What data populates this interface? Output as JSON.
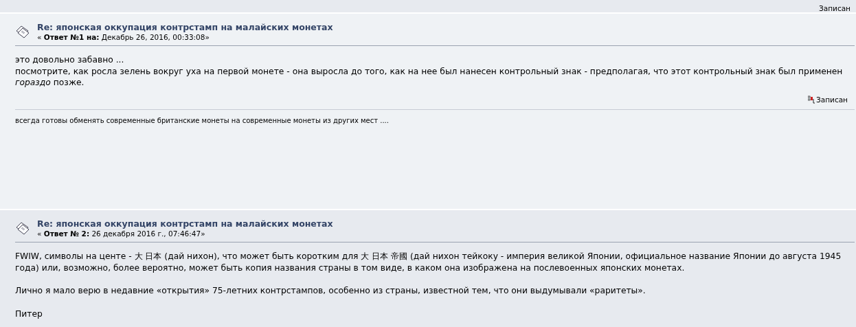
{
  "previous_post": {
    "report_link": "Записан"
  },
  "posts": [
    {
      "title": "Re: японская оккупация контрстамп на малайских монетах",
      "meta": "« **Ответ №1 на:** Декабрь 26, 2016, 00:33:08»",
      "paragraphs": [
        [
          "это довольно забавно ...",
          "посмотрите, как росла зелень вокруг уха на первой монете - она выросла до того, как на нее был нанесен контрольный знак - предполагая, что этот контрольный знак был применен *гораздо* позже."
        ]
      ],
      "report_link": "Записан",
      "signature": "всегда готовы обменять современные британские монеты на современные монеты из других мест ...."
    },
    {
      "title": "Re: японская оккупация контрстамп на малайских монетах",
      "meta": "« **Ответ № 2:** 26 декабря 2016 г., 07:46:47»",
      "paragraphs": [
        [
          "FWIW, символы на центе - 大 日本 (дай нихон), что может быть коротким для 大 日本 帝國 (дай нихон тейкоку - империя великой Японии, официальное название Японии до августа 1945 года) или, возможно, более вероятно, может быть копия названия страны в том виде, в каком она изображена на послевоенных японских монетах."
        ],
        [
          "Лично я мало верю в недавние «открытия» 75-летних контрстампов, особенно из страны, известной тем, что они выдумывали «раритеты»."
        ],
        [
          "Питер"
        ]
      ]
    }
  ]
}
